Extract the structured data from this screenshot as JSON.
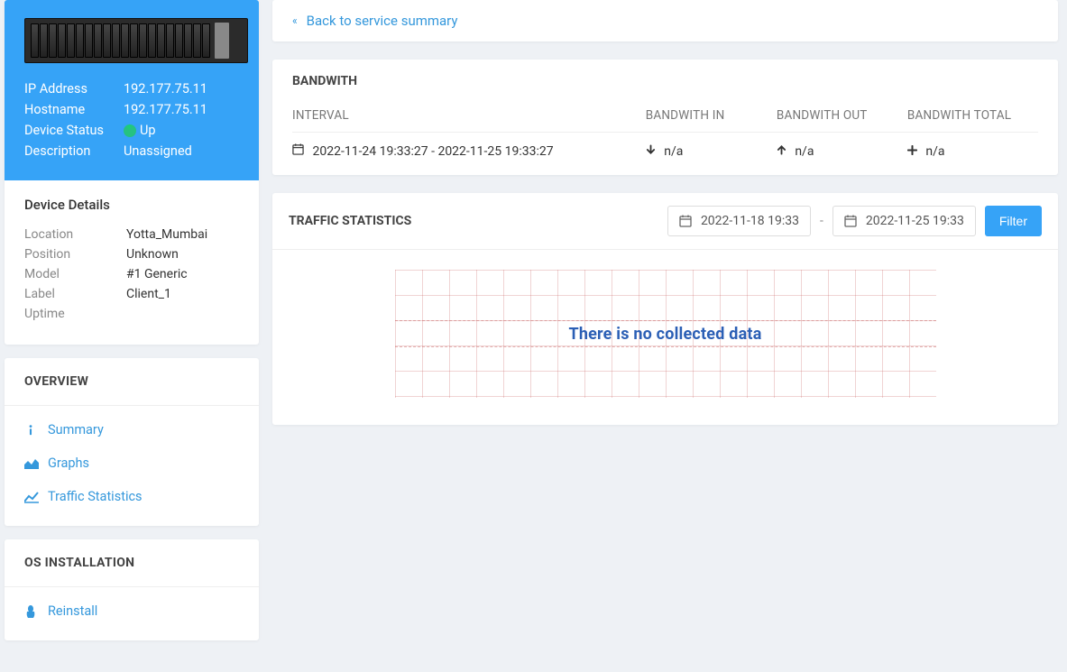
{
  "back_link": "Back to service summary",
  "device": {
    "ip_label": "IP Address",
    "ip_value": "192.177.75.11",
    "hostname_label": "Hostname",
    "hostname_value": "192.177.75.11",
    "status_label": "Device Status",
    "status_value": "Up",
    "description_label": "Description",
    "description_value": "Unassigned"
  },
  "device_details": {
    "title": "Device Details",
    "location_label": "Location",
    "location_value": "Yotta_Mumbai",
    "position_label": "Position",
    "position_value": "Unknown",
    "model_label": "Model",
    "model_value": "#1 Generic",
    "label_label": "Label",
    "label_value": "Client_1",
    "uptime_label": "Uptime",
    "uptime_value": ""
  },
  "overview": {
    "title": "OVERVIEW",
    "summary": "Summary",
    "graphs": "Graphs",
    "traffic": "Traffic Statistics"
  },
  "os_install": {
    "title": "OS INSTALLATION",
    "reinstall": "Reinstall"
  },
  "bandwidth": {
    "title": "BANDWITH",
    "col_interval": "INTERVAL",
    "col_in": "BANDWITH IN",
    "col_out": "BANDWITH OUT",
    "col_total": "BANDWITH TOTAL",
    "row_interval": "2022-11-24 19:33:27 - 2022-11-25 19:33:27",
    "row_in": "n/a",
    "row_out": "n/a",
    "row_total": "n/a"
  },
  "traffic": {
    "title": "TRAFFIC STATISTICS",
    "date_from": "2022-11-18 19:33",
    "date_to": "2022-11-25 19:33",
    "filter": "Filter",
    "no_data": "There is no collected data"
  }
}
